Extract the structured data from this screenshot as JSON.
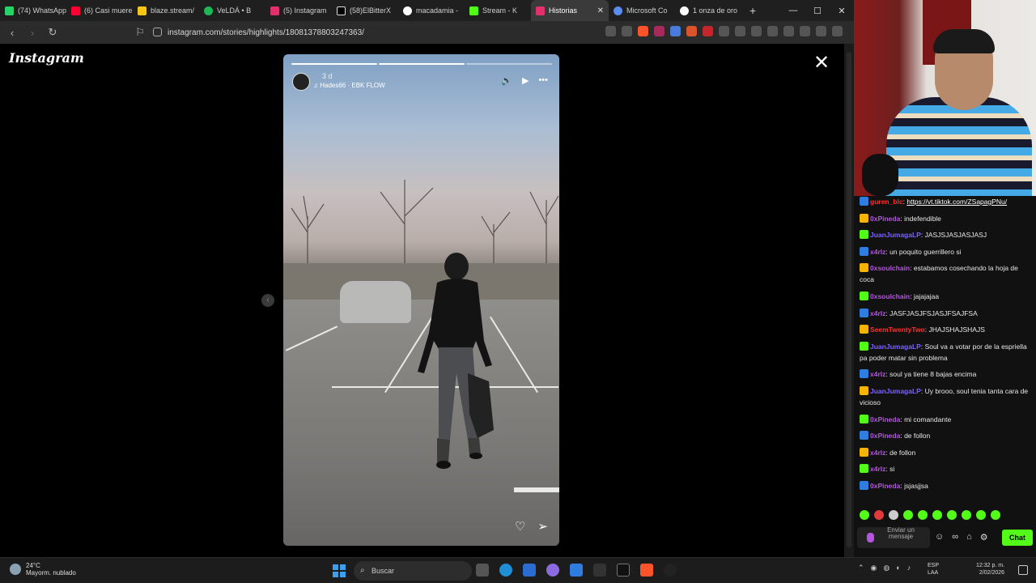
{
  "browser": {
    "tabs": [
      {
        "label": "(74) WhatsApp",
        "color": "#25d366"
      },
      {
        "label": "(6) Casi muere",
        "color": "#ff0033"
      },
      {
        "label": "blaze.stream/",
        "color": "#f5c518"
      },
      {
        "label": "VeLDÁ • B",
        "color": "#1db954"
      },
      {
        "label": "(5) Instagram",
        "color": "#e1306c"
      },
      {
        "label": "(58)ElBitterX",
        "color": "#ffffff"
      },
      {
        "label": "macadamia -",
        "color": "#ffffff"
      },
      {
        "label": "Stream - K",
        "color": "#53fc18"
      },
      {
        "label": "Historias",
        "color": "#e1306c",
        "active": true
      },
      {
        "label": "Microsoft Co",
        "color": "#5a8dee"
      },
      {
        "label": "1 onza de oro",
        "color": "#ffffff"
      }
    ],
    "new_tab": "+",
    "url": "instagram.com/stories/highlights/18081378803247363/"
  },
  "instagram": {
    "logo": "Instagram",
    "close": "✕",
    "prev_arrow": "‹",
    "story": {
      "time_ago": "3 d",
      "music": "Hades66 · EBK FLOW",
      "progress_segments": 3,
      "progress_completed": 2
    }
  },
  "chat": {
    "messages": [
      {
        "user": "guren_blc",
        "text": "https://vt.tiktok.com/ZSapagPNu/",
        "color": "#ff2e2e",
        "link": true
      },
      {
        "user": "0xPineda",
        "text": "indefendible",
        "color": "#b455e0"
      },
      {
        "user": "JuanJumagaLP",
        "text": "JASJSJASJASJASJ",
        "color": "#7a63ff"
      },
      {
        "user": "x4rlz",
        "text": "un poquito guerrillero si",
        "color": "#b455e0"
      },
      {
        "user": "0xsoulchain",
        "text": "estabamos cosechando la hoja de coca",
        "color": "#b455e0"
      },
      {
        "user": "0xsoulchain",
        "text": "jajajajaa",
        "color": "#b455e0"
      },
      {
        "user": "x4rlz",
        "text": "JASFJASJFSJASJFSAJFSA",
        "color": "#b455e0"
      },
      {
        "user": "SeemTwentyTwo",
        "text": "JHAJSHAJSHAJS",
        "color": "#ff2e2e"
      },
      {
        "user": "JuanJumagaLP",
        "text": "Soul va a votar por de la espriella pa poder matar sin problema",
        "color": "#7a63ff"
      },
      {
        "user": "x4rlz",
        "text": "soul ya tiene 8 bajas encima",
        "color": "#b455e0"
      },
      {
        "user": "JuanJumagaLP",
        "text": "Uy brooo, soul tenia tanta cara de vicioso",
        "color": "#7a63ff"
      },
      {
        "user": "0xPineda",
        "text": "mi comandante",
        "color": "#b455e0"
      },
      {
        "user": "0xPineda",
        "text": "de follon",
        "color": "#b455e0"
      },
      {
        "user": "x4rlz",
        "text": "de follon",
        "color": "#b455e0"
      },
      {
        "user": "x4rlz",
        "text": "si",
        "color": "#b455e0"
      },
      {
        "user": "0xPineda",
        "text": "jsjasjjsa",
        "color": "#b455e0"
      }
    ],
    "input_placeholder": "Enviar un mensaje",
    "send_label": "Chat",
    "accent": "#53fc18"
  },
  "taskbar": {
    "temperature": "24°C",
    "weather": "Mayorm. nublado",
    "search_label": "Buscar",
    "lang_line1": "ESP",
    "lang_line2": "LAA",
    "time": "12:32 p. m.",
    "date": "2/02/2026"
  }
}
